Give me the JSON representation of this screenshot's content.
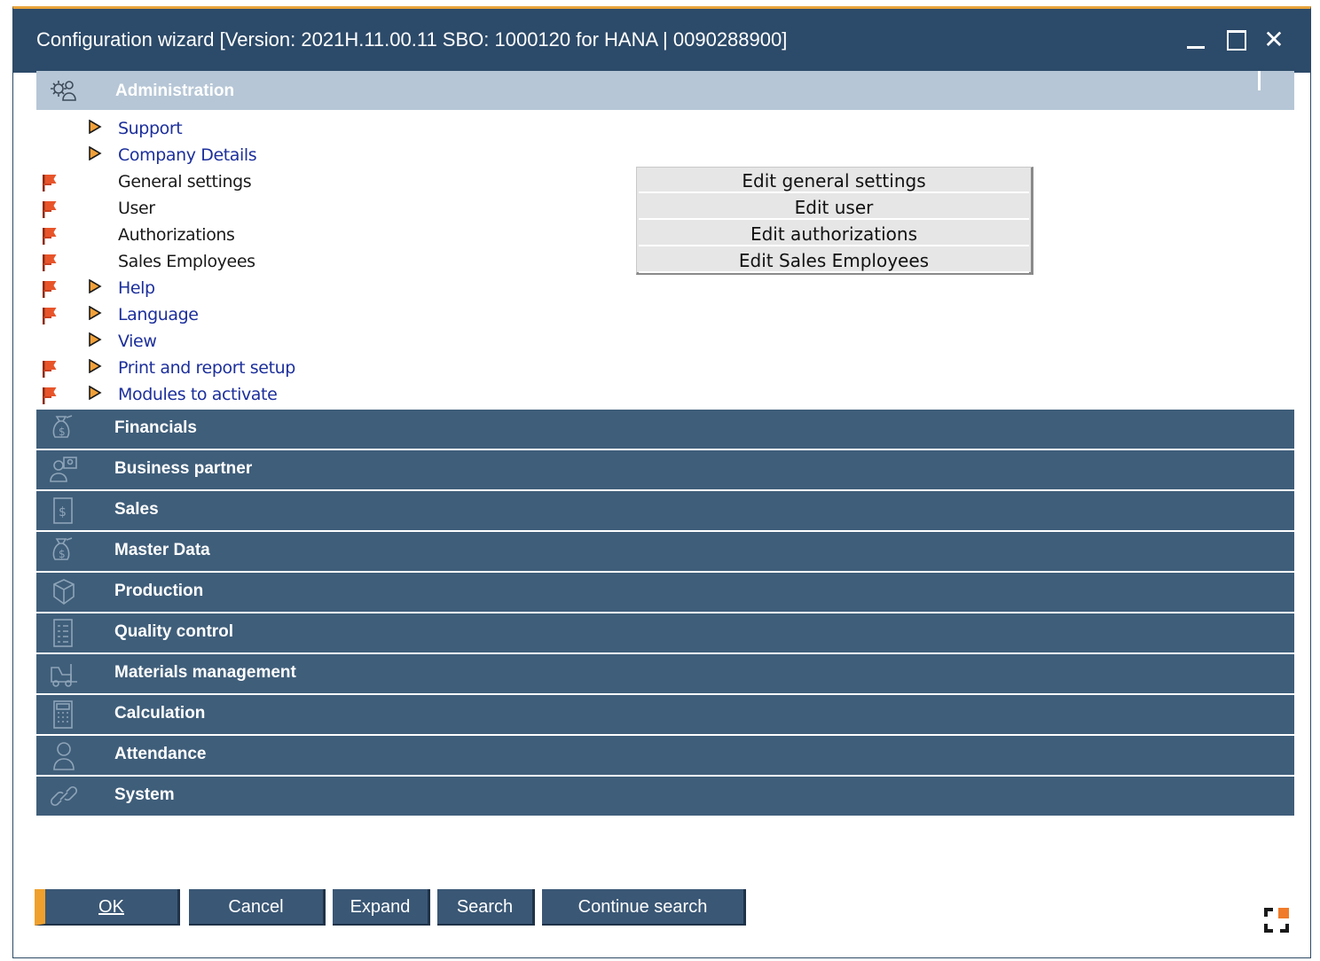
{
  "window": {
    "title": "Configuration wizard [Version: 2021H.11.00.11 SBO: 1000120 for HANA | 0090288900]",
    "minimize_label": "",
    "maximize_label": "",
    "close_label": "✕"
  },
  "admin": {
    "label": "Administration",
    "icon": "admin-gear-user-icon",
    "items": [
      {
        "label": "Support",
        "flag": false,
        "arrow": true,
        "link": true
      },
      {
        "label": "Company Details",
        "flag": false,
        "arrow": true,
        "link": true
      },
      {
        "label": "General settings",
        "flag": true,
        "arrow": false,
        "link": false
      },
      {
        "label": "User",
        "flag": true,
        "arrow": false,
        "link": false
      },
      {
        "label": "Authorizations",
        "flag": true,
        "arrow": false,
        "link": false
      },
      {
        "label": "Sales Employees",
        "flag": true,
        "arrow": false,
        "link": false
      },
      {
        "label": "Help",
        "flag": true,
        "arrow": true,
        "link": true
      },
      {
        "label": "Language",
        "flag": true,
        "arrow": true,
        "link": true
      },
      {
        "label": "View",
        "flag": false,
        "arrow": true,
        "link": true
      },
      {
        "label": "Print and report setup",
        "flag": true,
        "arrow": true,
        "link": true
      },
      {
        "label": "Modules to activate",
        "flag": true,
        "arrow": true,
        "link": true
      }
    ]
  },
  "popup": {
    "buttons": [
      "Edit general settings",
      "Edit user",
      "Edit authorizations",
      "Edit Sales Employees"
    ]
  },
  "sections": [
    {
      "label": "Financials",
      "icon": "money-bag-icon"
    },
    {
      "label": "Business partner",
      "icon": "business-partner-icon"
    },
    {
      "label": "Sales",
      "icon": "dollar-document-icon"
    },
    {
      "label": "Master Data",
      "icon": "money-bag-icon"
    },
    {
      "label": "Production",
      "icon": "cube-icon"
    },
    {
      "label": "Quality control",
      "icon": "checklist-icon"
    },
    {
      "label": "Materials management",
      "icon": "forklift-icon"
    },
    {
      "label": "Calculation",
      "icon": "calculator-icon"
    },
    {
      "label": "Attendance",
      "icon": "person-icon"
    },
    {
      "label": "System",
      "icon": "link-icon"
    }
  ],
  "buttons": {
    "ok": "OK",
    "cancel": "Cancel",
    "expand": "Expand",
    "search": "Search",
    "continue_search": "Continue search"
  },
  "colors": {
    "titlebar": "#2c4a69",
    "accent": "#e8a33b",
    "section": "#3f5e7a",
    "admin_header": "#b6c6d6",
    "link": "#1c2f9c",
    "flag": "#e8542a"
  }
}
